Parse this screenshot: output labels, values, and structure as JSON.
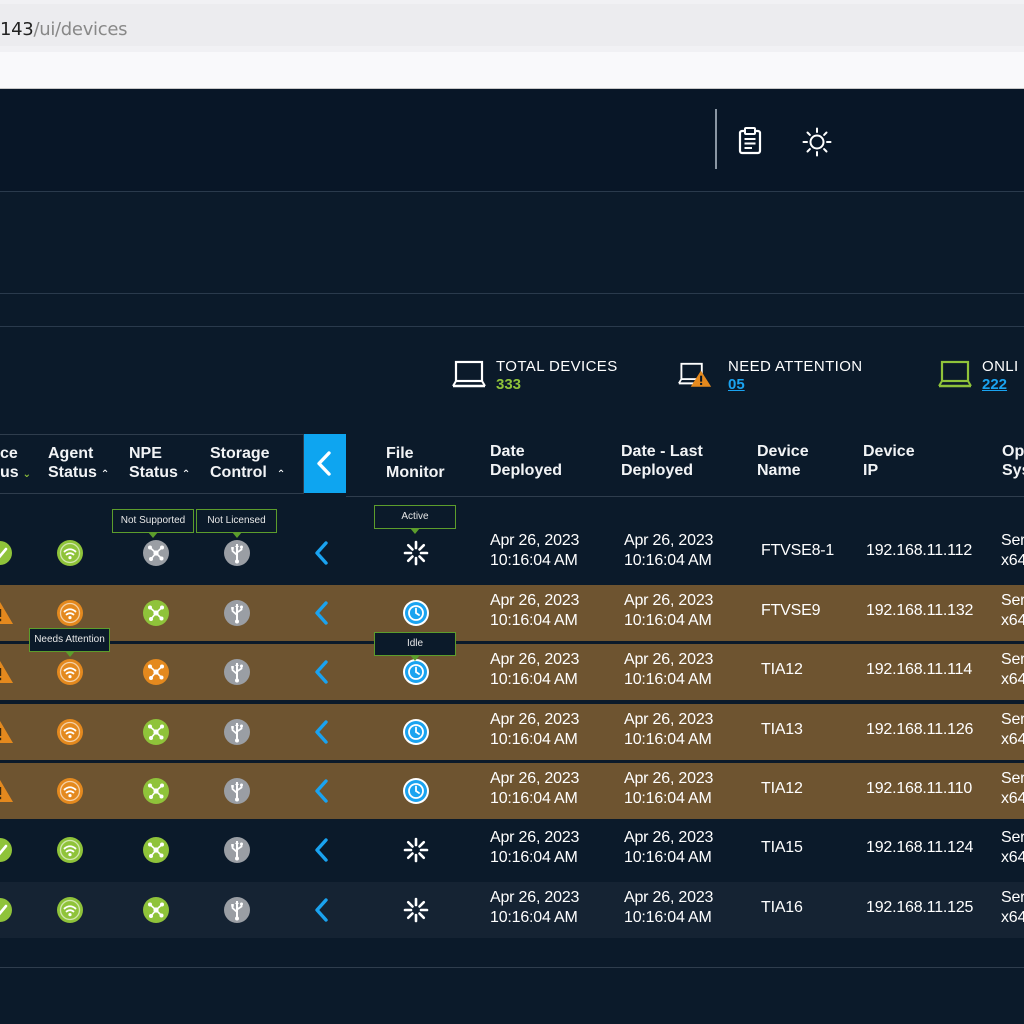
{
  "browser": {
    "url_host": "143",
    "url_path": "/ui/devices"
  },
  "header": {
    "icons": [
      "clipboard-icon",
      "sun-icon"
    ]
  },
  "summary": [
    {
      "label": "TOTAL DEVICES",
      "value": "333",
      "color": "#8fc33a",
      "icon": "laptop-icon"
    },
    {
      "label": "NEED ATTENTION",
      "value": "05",
      "color": "#1aa3f0",
      "icon": "laptop-warning-icon"
    },
    {
      "label": "ONLI",
      "value": "222",
      "color": "#1aa3f0",
      "icon": "laptop-online-icon"
    }
  ],
  "columns": {
    "device_status_1": "ce",
    "device_status_2": "us",
    "agent_1": "Agent",
    "agent_2": "Status",
    "npe_1": "NPE",
    "npe_2": "Status",
    "storage_1": "Storage",
    "storage_2": "Control",
    "file_1": "File",
    "file_2": "Monitor",
    "deployed_1": "Date",
    "deployed_2": "Deployed",
    "last_1": "Date - Last",
    "last_2": "Deployed",
    "name_1": "Device",
    "name_2": "Name",
    "ip_1": "Device",
    "ip_2": "IP",
    "os_1": "Op",
    "os_2": "Sys"
  },
  "tooltips": {
    "npe": "Not Supported",
    "storage": "Not Licensed",
    "file_active": "Active",
    "agent_attention": "Needs Attention",
    "file_idle": "Idle"
  },
  "rows": [
    {
      "status": "ok",
      "deployed_date": "Apr 26, 2023",
      "deployed_time": "10:16:04 AM",
      "last_date": "Apr 26, 2023",
      "last_time": "10:16:04 AM",
      "name": "FTVSE8-1",
      "ip": "192.168.11.112",
      "os_1": "Ser",
      "os_2": "x64"
    },
    {
      "status": "warn",
      "deployed_date": "Apr 26, 2023",
      "deployed_time": "10:16:04 AM",
      "last_date": "Apr 26, 2023",
      "last_time": "10:16:04 AM",
      "name": "FTVSE9",
      "ip": "192.168.11.132",
      "os_1": "Ser",
      "os_2": "x64"
    },
    {
      "status": "warn",
      "deployed_date": "Apr 26, 2023",
      "deployed_time": "10:16:04 AM",
      "last_date": "Apr 26, 2023",
      "last_time": "10:16:04 AM",
      "name": "TIA12",
      "ip": "192.168.11.114",
      "os_1": "Ser",
      "os_2": "x64"
    },
    {
      "status": "warn",
      "deployed_date": "Apr 26, 2023",
      "deployed_time": "10:16:04 AM",
      "last_date": "Apr 26, 2023",
      "last_time": "10:16:04 AM",
      "name": "TIA13",
      "ip": "192.168.11.126",
      "os_1": "Ser",
      "os_2": "x64"
    },
    {
      "status": "warn",
      "deployed_date": "Apr 26, 2023",
      "deployed_time": "10:16:04 AM",
      "last_date": "Apr 26, 2023",
      "last_time": "10:16:04 AM",
      "name": "TIA12",
      "ip": "192.168.11.110",
      "os_1": "Ser",
      "os_2": "x64"
    },
    {
      "status": "ok",
      "deployed_date": "Apr 26, 2023",
      "deployed_time": "10:16:04 AM",
      "last_date": "Apr 26, 2023",
      "last_time": "10:16:04 AM",
      "name": "TIA15",
      "ip": "192.168.11.124",
      "os_1": "Ser",
      "os_2": "x64"
    },
    {
      "status": "ok",
      "deployed_date": "Apr 26, 2023",
      "deployed_time": "10:16:04 AM",
      "last_date": "Apr 26, 2023",
      "last_time": "10:16:04 AM",
      "name": "TIA16",
      "ip": "192.168.11.125",
      "os_1": "Ser",
      "os_2": "x64"
    }
  ],
  "colors": {
    "ok_green": "#8fc33a",
    "warn_orange": "#e4891e",
    "info_blue": "#1aa3f0",
    "neutral_gray": "#9a9ea4",
    "warn_row": "#6e5430"
  }
}
